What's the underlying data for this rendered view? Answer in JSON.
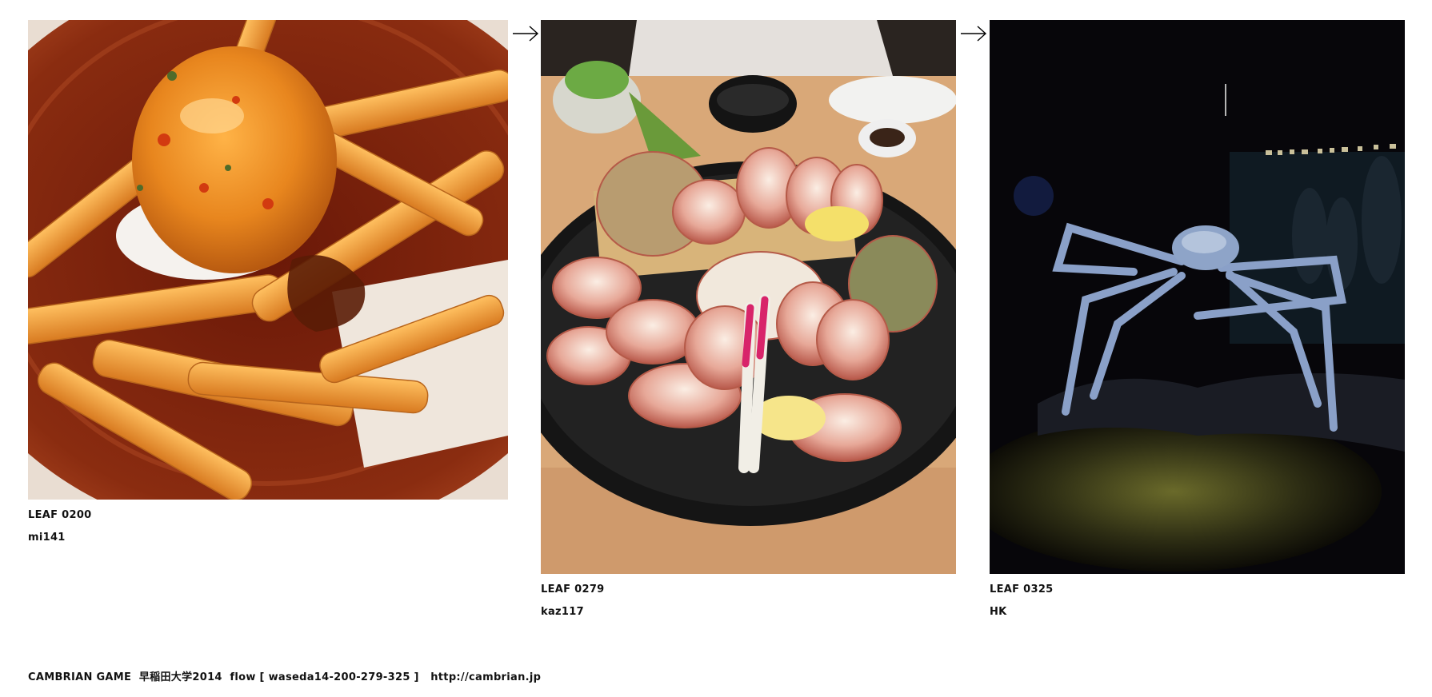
{
  "leaves": [
    {
      "leaf": "LEAF 0200",
      "user": "mi141",
      "subject": "fries-with-sauce-photo"
    },
    {
      "leaf": "LEAF 0279",
      "user": "kaz117",
      "subject": "crab-platter-photo"
    },
    {
      "leaf": "LEAF 0325",
      "user": "HK",
      "subject": "spider-crab-aquarium-photo"
    }
  ],
  "arrow_icon": "right-arrow-icon",
  "footer": {
    "game": "CAMBRIAN GAME",
    "event": "早稲田大学2014",
    "flow": "flow [ waseda14-200-279-325 ]",
    "url": "http://cambrian.jp"
  }
}
